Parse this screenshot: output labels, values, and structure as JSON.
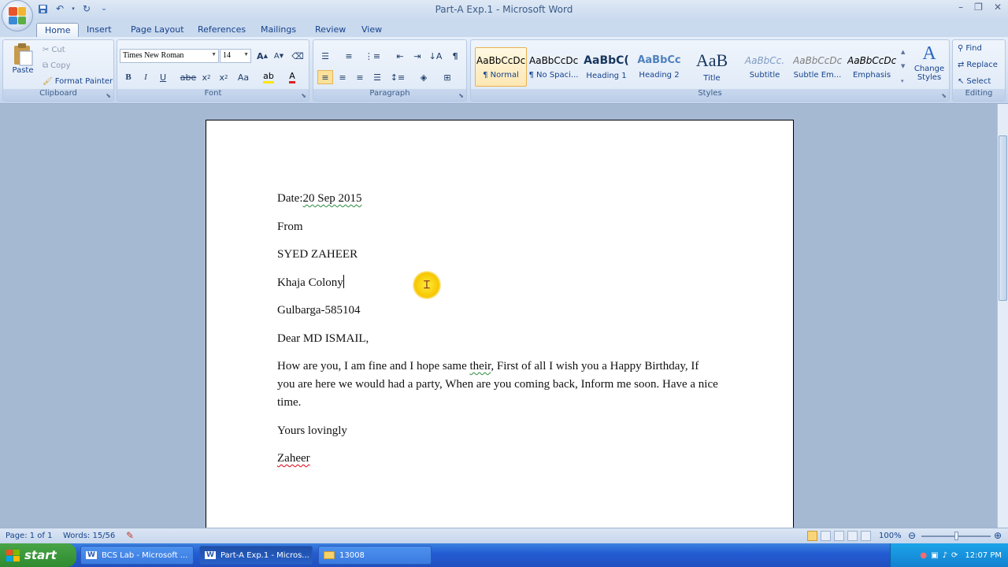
{
  "window": {
    "title": "Part-A Exp.1 - Microsoft Word"
  },
  "tabs": [
    "Home",
    "Insert",
    "Page Layout",
    "References",
    "Mailings",
    "Review",
    "View"
  ],
  "clipboard": {
    "paste": "Paste",
    "cut": "Cut",
    "copy": "Copy",
    "format_painter": "Format Painter",
    "label": "Clipboard"
  },
  "font": {
    "name": "Times New Roman",
    "size": "14",
    "label": "Font"
  },
  "paragraph": {
    "label": "Paragraph"
  },
  "styles": {
    "items": [
      {
        "preview": "AaBbCcDc",
        "name": "¶ Normal"
      },
      {
        "preview": "AaBbCcDc",
        "name": "¶ No Spaci..."
      },
      {
        "preview": "AaBbC(",
        "name": "Heading 1"
      },
      {
        "preview": "AaBbCc",
        "name": "Heading 2"
      },
      {
        "preview": "AaB",
        "name": "Title"
      },
      {
        "preview": "AaBbCc.",
        "name": "Subtitle"
      },
      {
        "preview": "AaBbCcDc",
        "name": "Subtle Em..."
      },
      {
        "preview": "AaBbCcDc",
        "name": "Emphasis"
      }
    ],
    "change": "Change Styles",
    "label": "Styles"
  },
  "editing": {
    "find": "Find",
    "replace": "Replace",
    "select": "Select",
    "label": "Editing"
  },
  "document": {
    "date_prefix": "Date:",
    "date_value": "20 Sep 2015",
    "from": "From",
    "name": "SYED ZAHEER",
    "address1": "Khaja Colony",
    "address2": "Gulbarga-585104",
    "salutation": "Dear MD ISMAIL,",
    "body_a": "How are you, I am fine and I hope same ",
    "body_b": "their",
    "body_c": ", First of all I wish you a Happy Birthday, If you are here we would had a party, When are you coming back, Inform me soon. Have a nice time.",
    "closing": "Yours lovingly",
    "signature": "Zaheer"
  },
  "status": {
    "page": "Page: 1 of 1",
    "words": "Words: 15/56",
    "zoom": "100%"
  },
  "taskbar": {
    "start": "start",
    "items": [
      "BCS Lab - Microsoft ...",
      "Part-A Exp.1 - Micros...",
      "13008"
    ],
    "clock": "12:07 PM"
  }
}
